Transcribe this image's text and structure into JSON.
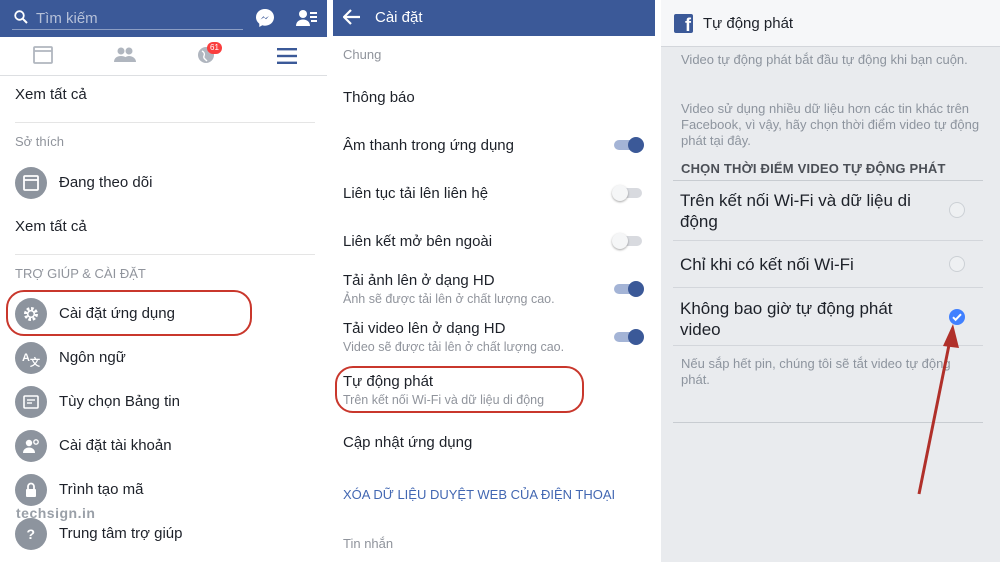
{
  "left_panel": {
    "search": {
      "placeholder": "Tìm kiếm"
    },
    "badge_count": "61",
    "see_all_1": "Xem tất cả",
    "interests_header": "Sở thích",
    "following": "Đang theo dõi",
    "see_all_2": "Xem tất cả",
    "help_header": "TRỢ GIÚP & CÀI ĐẶT",
    "items": [
      {
        "label": "Cài đặt ứng dụng",
        "icon": "gear-icon"
      },
      {
        "label": "Ngôn ngữ",
        "icon": "language-icon"
      },
      {
        "label": "Tùy chọn Bảng tin",
        "icon": "news-feed-icon"
      },
      {
        "label": "Cài đặt tài khoản",
        "icon": "account-settings-icon"
      },
      {
        "label": "Trình tạo mã",
        "icon": "code-generator-icon"
      },
      {
        "label": "Trung tâm trợ giúp",
        "icon": "help-icon"
      }
    ],
    "watermark": "techsign.in"
  },
  "middle_panel": {
    "title": "Cài đặt",
    "general_header": "Chung",
    "notifications": "Thông báo",
    "in_app_sound": "Âm thanh trong ứng dụng",
    "continuous_upload": "Liên tục tải lên liên hệ",
    "external_links": "Liên kết mở bên ngoài",
    "upload_photo_hd": "Tải ảnh lên ở dạng HD",
    "upload_photo_hd_sub": "Ảnh sẽ được tải lên ở chất lượng cao.",
    "upload_video_hd": "Tải video lên ở dạng HD",
    "upload_video_hd_sub": "Video sẽ được tải lên ở chất lượng cao.",
    "autoplay": "Tự động phát",
    "autoplay_sub": "Trên kết nối Wi-Fi và dữ liệu di động",
    "update_app": "Cập nhật ứng dụng",
    "clear_data": "XÓA DỮ LIỆU DUYỆT WEB CỦA ĐIỆN THOẠI",
    "messages_header": "Tin nhắn",
    "toggles": {
      "in_app_sound": true,
      "continuous_upload": false,
      "external_links": false,
      "upload_photo_hd": true,
      "upload_video_hd": true
    }
  },
  "right_panel": {
    "title": "Tự động phát",
    "desc1": "Video tự động phát bắt đầu tự động khi bạn cuộn.",
    "desc2": "Video sử dụng nhiều dữ liệu hơn các tin khác trên Facebook, vì vậy, hãy chọn thời điểm video tự động phát tại đây.",
    "choose_header": "CHỌN THỜI ĐIỂM VIDEO TỰ ĐỘNG PHÁT",
    "options": [
      {
        "label": "Trên kết nối Wi-Fi và dữ liệu di động",
        "selected": false
      },
      {
        "label": "Chỉ khi có kết nối Wi-Fi",
        "selected": false
      },
      {
        "label": "Không bao giờ tự động phát video",
        "selected": true
      }
    ],
    "battery_note": "Nếu sắp hết pin, chúng tôi sẽ tắt video tự động phát."
  },
  "colors": {
    "facebook_blue": "#3b5998",
    "highlight_red": "#c9372c",
    "radio_blue": "#4080ff",
    "arrow_red": "#b0302a"
  }
}
